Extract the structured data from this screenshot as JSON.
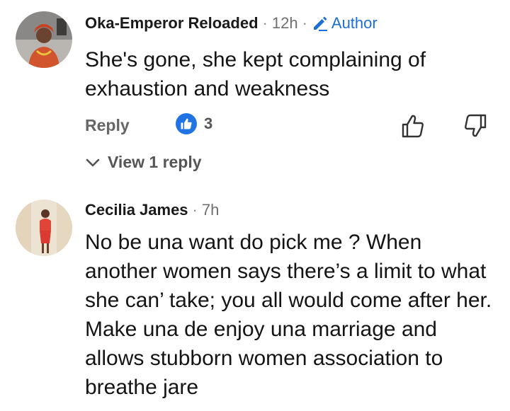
{
  "comments": [
    {
      "author": "Oka-Emperor Reloaded",
      "separator": "·",
      "time": "12h",
      "badge": "Author",
      "text": "She's gone, she kept complaining of exhaustion and weakness",
      "reply_label": "Reply",
      "likes": "3",
      "view_replies_label": "View 1 reply",
      "icons": [
        "avatar",
        "pencil-icon",
        "like-badge-icon",
        "thumbs-up-icon",
        "thumbs-down-icon",
        "chevron-down-icon"
      ]
    },
    {
      "author": "Cecilia James",
      "separator": "·",
      "time": "7h",
      "text": "No be una want do pick me ? When another women says there’s a limit to what she can’ take; you all would come after her. Make una de enjoy una marriage and allows stubborn women association to breathe jare",
      "icons": [
        "avatar"
      ]
    }
  ],
  "colors": {
    "accent": "#1d6fd8",
    "like_badge": "#1f73e3",
    "muted_text": "#666666"
  }
}
